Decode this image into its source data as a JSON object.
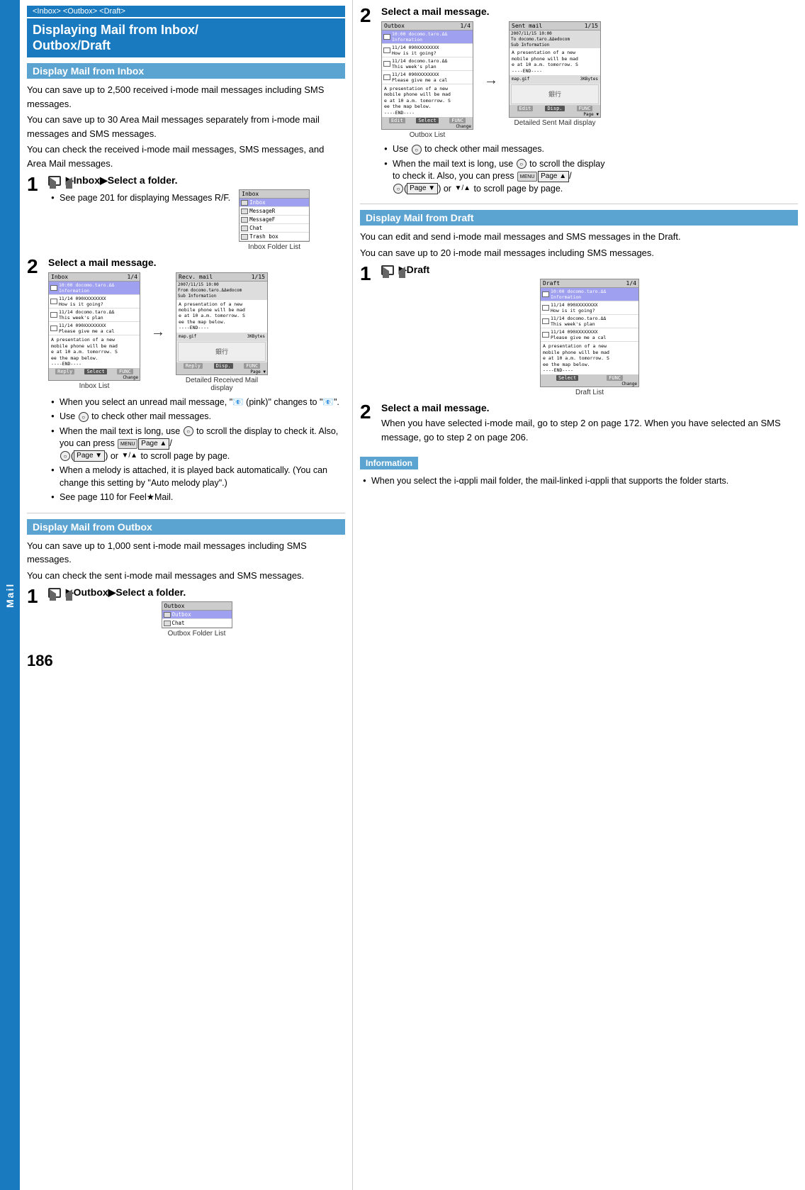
{
  "sidebar": {
    "label": "Mail"
  },
  "page": {
    "number": "186",
    "top_banner": "<Inbox> <Outbox> <Draft>",
    "main_title_line1": "Displaying Mail from Inbox/",
    "main_title_line2": "Outbox/Draft"
  },
  "left_col": {
    "inbox_section": {
      "title": "Display Mail from Inbox",
      "body_lines": [
        "You can save up to 2,500 received i-mode mail",
        "messages including SMS messages.",
        "You can save up to 30 Area Mail messages separately",
        "from i-mode mail messages and SMS messages.",
        "You can check the received i-mode mail messages,",
        "SMS messages, and Area Mail messages."
      ],
      "step1": {
        "number": "1",
        "title_prefix": "▶",
        "title_text": "Inbox▶Select a folder.",
        "bullet1": "See page 201 for displaying Messages R/F.",
        "screen_caption": "Inbox Folder List"
      },
      "step2": {
        "number": "2",
        "title_text": "Select a mail message.",
        "screen1_caption": "Inbox List",
        "screen2_caption_line1": "Detailed Received Mail",
        "screen2_caption_line2": "display",
        "bullets": [
          "When you select an unread mail message, \" (pink)\" changes to \" \".",
          "Use  to check other mail messages.",
          "When the mail text is long, use  to scroll the display to check it. Also, you can press (Page ▲)/ (Page ▼) or ▼/▲ to scroll page by page.",
          "When a melody is attached, it is played back automatically. (You can change this setting by \"Auto melody play\".)",
          "See page 110 for Feel★Mail."
        ]
      }
    },
    "outbox_section": {
      "title": "Display Mail from Outbox",
      "body_lines": [
        "You can save up to 1,000 sent i-mode mail messages",
        "including SMS messages.",
        "You can check the sent i-mode mail messages and",
        "SMS messages."
      ],
      "step1": {
        "number": "1",
        "title_text": "▶Outbox▶Select a folder.",
        "screen_caption": "Outbox Folder List"
      }
    }
  },
  "right_col": {
    "step2_outbox": {
      "number": "2",
      "title_text": "Select a mail message.",
      "screen1_caption": "Outbox List",
      "screen2_caption": "Detailed Sent Mail display",
      "bullets": [
        "Use  to check other mail messages.",
        "When the mail text is long, use  to scroll the display to check it. Also, you can press (Page ▲)/ (Page ▼) or ▼/▲ to scroll page by page."
      ]
    },
    "draft_section": {
      "title": "Display Mail from Draft",
      "body_lines": [
        "You can edit and send i-mode mail messages and SMS",
        "messages in the Draft.",
        "You can save up to 20 i-mode mail messages including",
        "SMS messages."
      ],
      "step1": {
        "number": "1",
        "title_text": "▶Draft",
        "screen_caption": "Draft List"
      },
      "step2": {
        "number": "2",
        "title_text": "Select a mail message.",
        "body": "When you have selected i-mode mail, go to step 2 on page 172. When you have selected an SMS message, go to step 2 on page 206."
      }
    },
    "information": {
      "label": "Information",
      "bullet": "When you select the i-αppli mail folder, the mail-linked i-αppli that supports the folder starts."
    }
  },
  "screens": {
    "inbox_folder": {
      "header": "Inbox",
      "rows": [
        "Inbox",
        "MessageR",
        "MessageF",
        "Chat",
        "Trash box"
      ]
    },
    "inbox_list": {
      "header": "Inbox   1/4",
      "rows": [
        "10:00 docomo.taro.ΔΔ Information",
        "11/14 090XXXXXXXX How is it going?",
        "11/14 docomo.taro.ΔΔ This week's plan",
        "11/14 090XXXXXXXX Please give me a cal"
      ],
      "body": "A presentation of a new mobile phone will be made at 10 a.m. tomorrow. See the map below. ----END----"
    },
    "inbox_detail": {
      "header": "Recv. mail  1/15",
      "from": "2007/11/15 10:00 docomo.taro.ΔΔedocom",
      "sub": "Information",
      "body": "A presentation of a new mobile phone will be made at 10 a.m. tomorrow. See the map below. ----END----",
      "attachment": "map.gif  3KBytes",
      "image_label": "銀行"
    },
    "outbox_folder": {
      "header": "Outbox",
      "rows": [
        "Outbox",
        "Chat"
      ]
    },
    "outbox_list": {
      "header": "Outbox  1/4",
      "rows": [
        "10:00 docomo.taro.ΔΔ Information",
        "11/14 090XXXXXXXX How is it going?",
        "11/14 docomo.taro.ΔΔ This week's plan",
        "11/14 090XXXXXXXX Please give me a cal"
      ],
      "body": "A presentation of a new mobile phone will be made at 10 a.m. tomorrow. See the map below. ----END----"
    },
    "sent_detail": {
      "header": "Sent mail  1/15",
      "to": "2007/11/15 10:00 docomo.taro.ΔΔedocom",
      "sub": "Information",
      "body": "A presentation of a new mobile phone will be mad e at 10 a.m. tomorrow. S ----END----",
      "attachment": "map.gif  3KBytes",
      "image_label": "銀行"
    },
    "draft_list": {
      "header": "Draft  1/4",
      "rows": [
        "10:00 docomo.taro.ΔΔ Information",
        "11/14 090XXXXXXXX How is it going?",
        "11/14 docomo.taro.ΔΔ This week's plan",
        "11/14 090XXXXXXXX Please give me a cal"
      ],
      "body": "A presentation of a new mobile phone will be mad e at 10 a.m. tomorrow. S ee the map below. ----END----"
    }
  }
}
